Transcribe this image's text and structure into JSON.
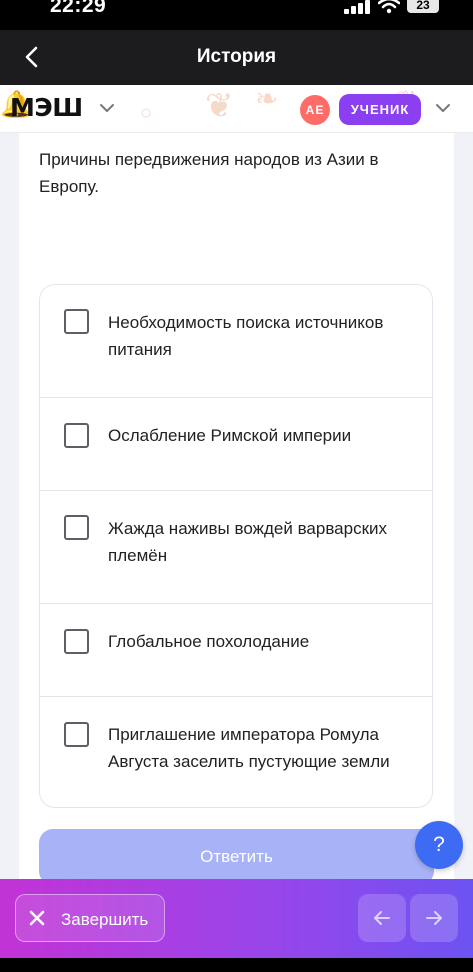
{
  "status_bar": {
    "time": "22:29",
    "battery": "23"
  },
  "nav": {
    "title": "История",
    "back_icon": "chevron-left-icon"
  },
  "header": {
    "logo_text": "МЭШ",
    "avatar_initials": "АЕ",
    "role": "УЧЕНИК",
    "accent": "#8a3ff0",
    "avatar_color": "#ff6b66"
  },
  "question": {
    "text": "Причины передвижения народов из Азии в Европу."
  },
  "options": [
    {
      "label": "Необходимость поиска источников питания",
      "checked": false
    },
    {
      "label": "Ослабление Римской империи",
      "checked": false
    },
    {
      "label": "Жажда наживы вождей варварских племён",
      "checked": false
    },
    {
      "label": "Глобальное похолодание",
      "checked": false
    },
    {
      "label": "Приглашение императора Ромула Августа заселить пустующие земли",
      "checked": false
    }
  ],
  "actions": {
    "answer_label": "Ответить",
    "help_label": "?",
    "finish_label": "Завершить"
  }
}
